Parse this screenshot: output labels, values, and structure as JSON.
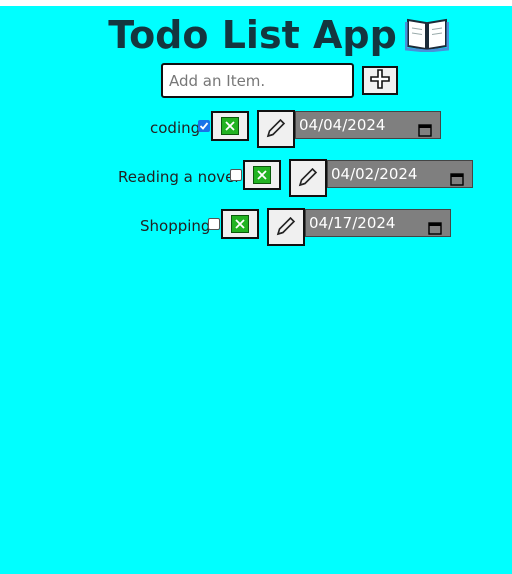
{
  "app": {
    "title": "Todo List App",
    "title_icon": "open-book-icon",
    "background": "#00ffff"
  },
  "add": {
    "placeholder": "Add an Item.",
    "value": "",
    "button_icon": "plus-icon"
  },
  "items": [
    {
      "label": "coding",
      "checked": true,
      "date": "04/04/2024"
    },
    {
      "label": "Reading a novel",
      "checked": false,
      "date": "04/02/2024"
    },
    {
      "label": "Shopping",
      "checked": false,
      "date": "04/17/2024"
    }
  ]
}
